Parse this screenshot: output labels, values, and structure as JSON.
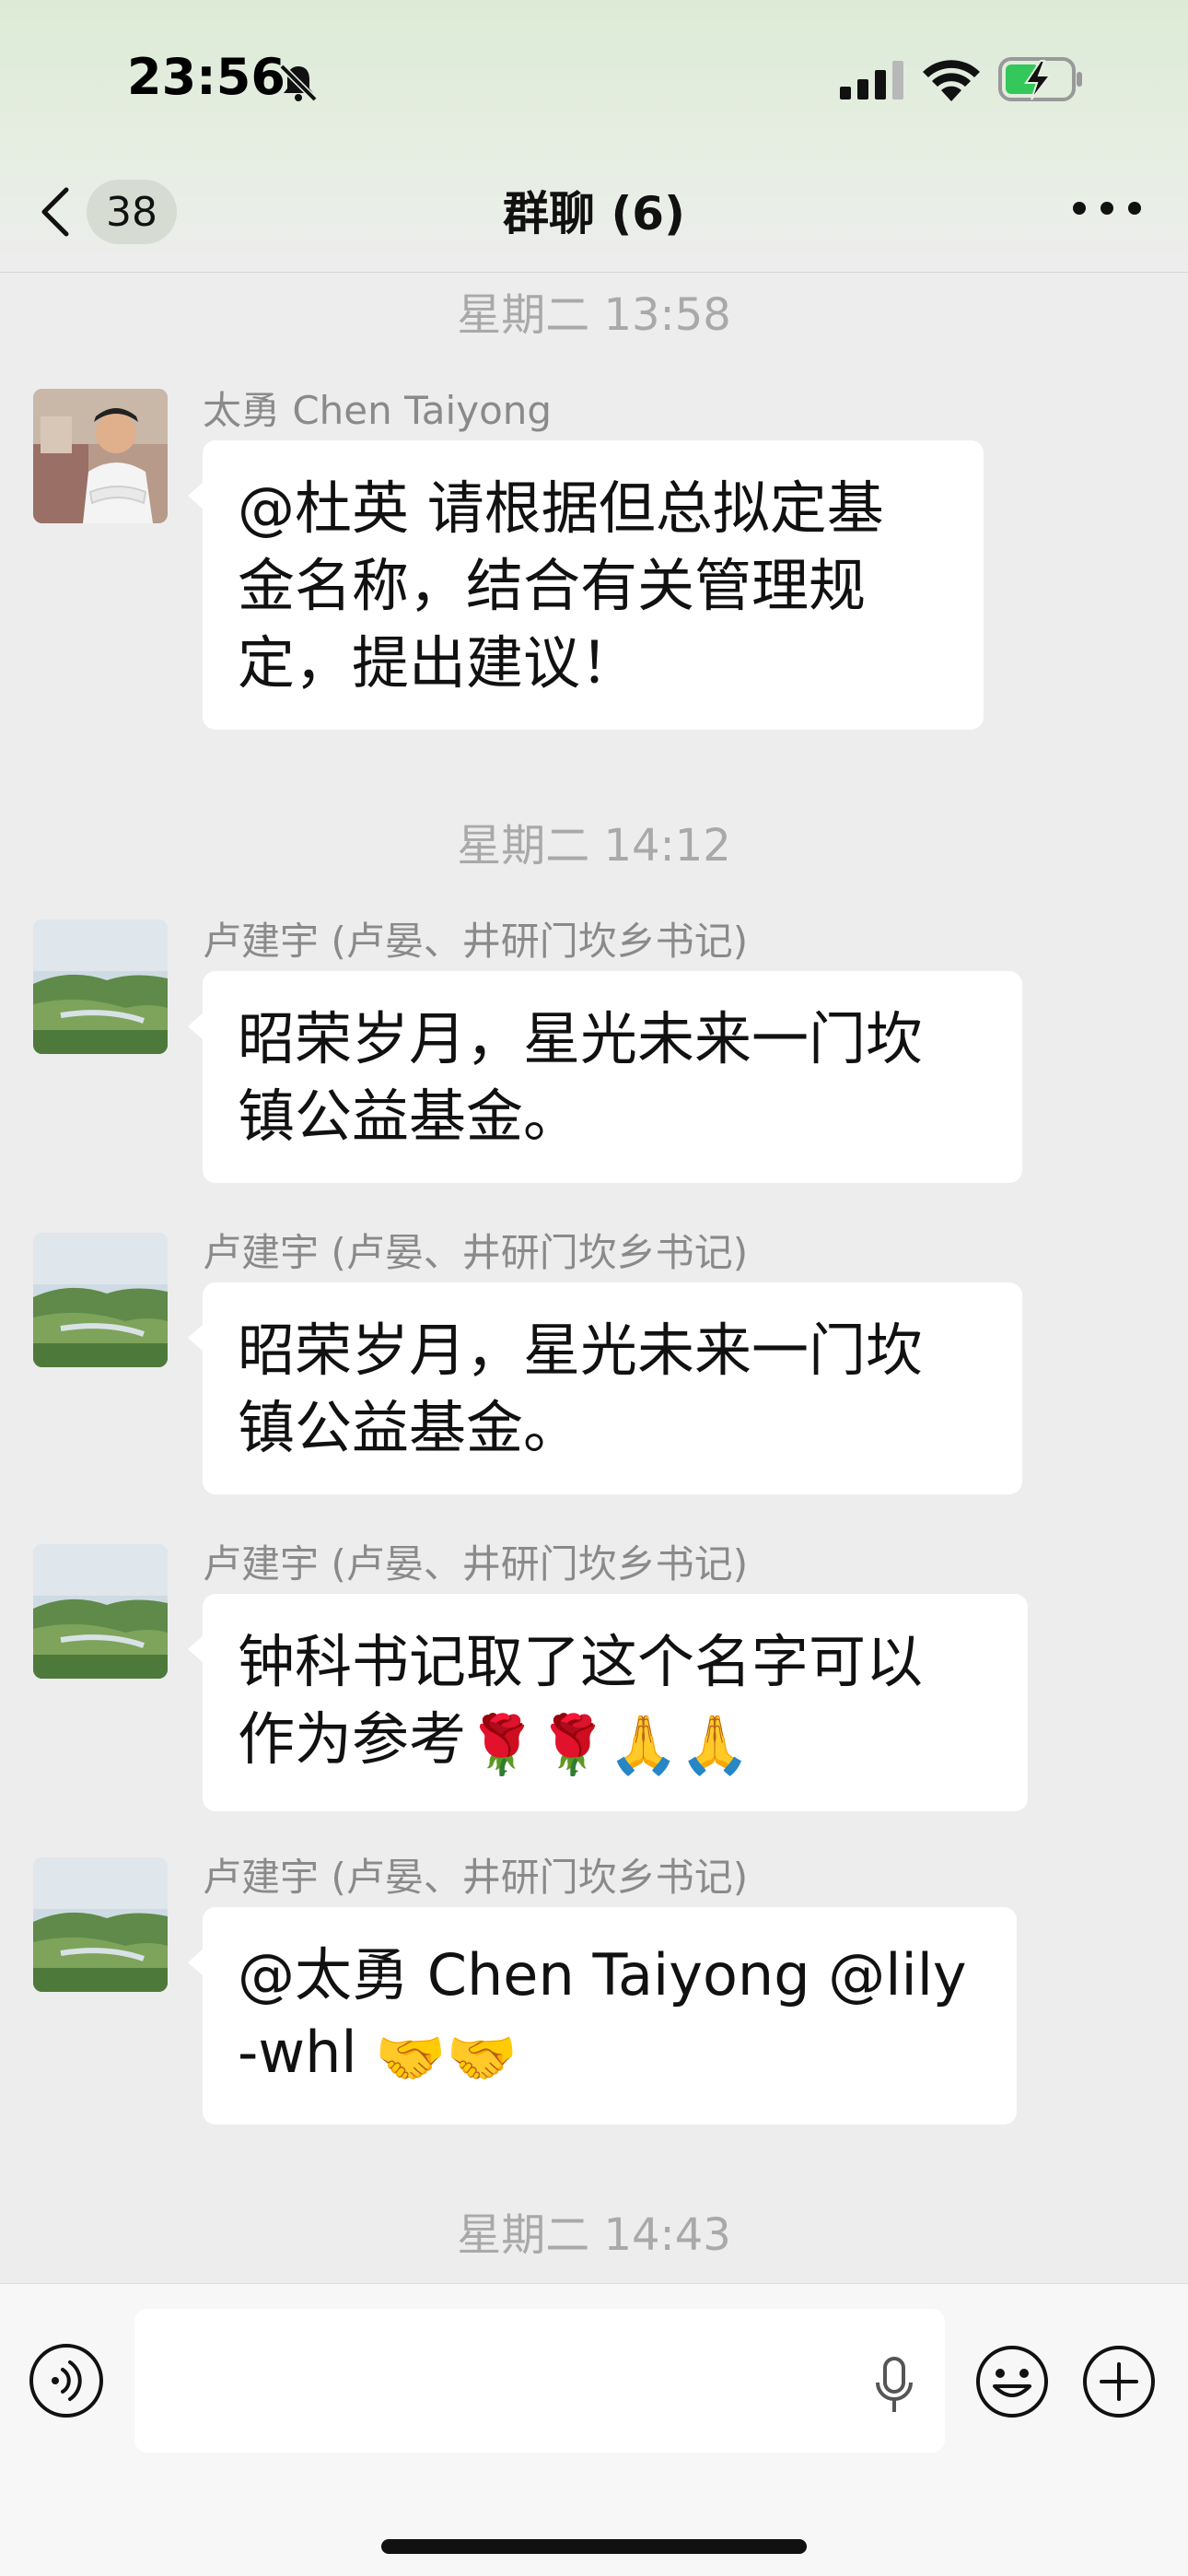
{
  "status_bar": {
    "time": "23:56"
  },
  "nav": {
    "unread_count": "38",
    "title": "群聊 (6)"
  },
  "messages": [
    {
      "timestamp": "星期二 13:58",
      "sender": "太勇 Chen Taiyong",
      "lines": [
        "@杜英 请根据但总拟定基",
        "金名称，结合有关管理规",
        "定，提出建议！"
      ]
    },
    {
      "timestamp": "星期二 14:12",
      "sender": "卢建宇 (卢晏、井研门坎乡书记)",
      "lines": [
        "昭荣岁月，星光未来一门坎",
        "镇公益基金。"
      ]
    },
    {
      "sender": "卢建宇 (卢晏、井研门坎乡书记)",
      "lines": [
        "昭荣岁月，星光未来一门坎",
        "镇公益基金。"
      ]
    },
    {
      "sender": "卢建宇 (卢晏、井研门坎乡书记)",
      "lines": [
        "钟科书记取了这个名字可以",
        "作为参考"
      ],
      "emojis": [
        "🌹",
        "🌹",
        "🙏",
        "🙏"
      ]
    },
    {
      "sender": "卢建宇 (卢晏、井研门坎乡书记)",
      "lines": [
        "@太勇 Chen Taiyong @lily",
        "-whl"
      ],
      "emojis": [
        "🤝",
        "🤝"
      ]
    }
  ],
  "last_timestamp": "星期二 14:43",
  "input": {
    "value": "",
    "placeholder": ""
  },
  "icons": {
    "back": "chevron-left-icon",
    "more": "more-dots-icon",
    "voice": "voice-icon",
    "mic": "mic-icon",
    "emoji": "emoji-icon",
    "plus": "plus-icon"
  }
}
